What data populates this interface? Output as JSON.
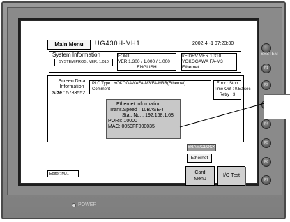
{
  "device": {
    "power_label": "POWER",
    "system_label": "SYSTEM",
    "function_keys": [
      "F1",
      "F2",
      "F3",
      "F4",
      "F5",
      "F6",
      "F7"
    ]
  },
  "header": {
    "main_menu_label": "Main Menu",
    "model": "UG430H-VH1",
    "datetime": "2002-4 -1   07:23:30"
  },
  "system_info": {
    "title": "System Information",
    "prog_ver": "SYSTEM PROG. VER. 1.010",
    "font_title": "FONT",
    "font_ver": "VER.1.300 / 1.000 / 1.000",
    "font_lang": "ENGLISH",
    "drv_ver": "I/F DRV VER.1.310",
    "drv_maker": "YOKOGAWA FA-M3",
    "drv_type": "Ethernet"
  },
  "screen_data": {
    "label_line1": "Screen Data",
    "label_line2": "Information",
    "size_label": "Size",
    "size_value": ": 5783552",
    "plc_type": "PLC Type : YOKOGAWAFA-M3/FA-M3R(Ethernet)",
    "comment": "Comment :",
    "error": "Error : Stop",
    "timeout": "Time-Out : 0.50  sec",
    "retry": "Retry : 3"
  },
  "ethernet": {
    "title": "Ethernet Information",
    "trans_speed": "Trans.Speed : 10BASE-T",
    "stat_no": "Stat. No. : 192.168.1.68",
    "port": "PORT: 10000",
    "mac": "MAC: 0050FF000035"
  },
  "buttons": {
    "sram_clock": "SRAM/CLOCK",
    "ethernet": "Ethernet",
    "card_menu_line1": "Card",
    "card_menu_line2": "Menu",
    "io_test": "I/O Test"
  },
  "editor": "Editor: MJ1"
}
